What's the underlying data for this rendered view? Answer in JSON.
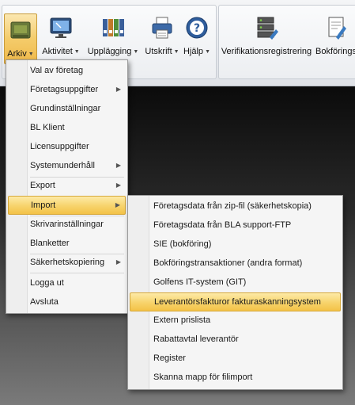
{
  "ribbon": {
    "buttons": [
      {
        "label": "Arkiv",
        "icon": "archive-icon",
        "active": true
      },
      {
        "label": "Aktivitet",
        "icon": "monitor-icon"
      },
      {
        "label": "Upplägging",
        "icon": "binders-icon"
      },
      {
        "label": "Utskrift",
        "icon": "printer-icon"
      },
      {
        "label": "Hjälp",
        "icon": "help-icon"
      },
      {
        "label": "Verifikationsregistrering",
        "icon": "server-edit-icon"
      },
      {
        "label": "Bokförings",
        "icon": "document-pen-icon"
      }
    ]
  },
  "arkiv_menu": {
    "items": [
      {
        "label": "Val av företag",
        "submenu": false
      },
      {
        "label": "Företagsuppgifter",
        "submenu": true
      },
      {
        "label": "Grundinställningar",
        "submenu": false
      },
      {
        "label": "BL Klient",
        "submenu": false
      },
      {
        "label": "Licensuppgifter",
        "submenu": false
      },
      {
        "label": "Systemunderhåll",
        "submenu": true
      },
      {
        "label": "Export",
        "submenu": true
      },
      {
        "label": "Import",
        "submenu": true,
        "highlighted": true
      },
      {
        "label": "Skrivarinställningar",
        "submenu": false
      },
      {
        "label": "Blanketter",
        "submenu": false
      },
      {
        "label": "Säkerhetskopiering",
        "submenu": true
      },
      {
        "label": "Logga ut",
        "submenu": false
      },
      {
        "label": "Avsluta",
        "submenu": false
      }
    ]
  },
  "import_menu": {
    "items": [
      {
        "label": "Företagsdata från zip-fil (säkerhetskopia)"
      },
      {
        "label": "Företagsdata från BLA support-FTP"
      },
      {
        "label": "SIE (bokföring)"
      },
      {
        "label": "Bokföringstransaktioner (andra format)"
      },
      {
        "label": "Golfens IT-system (GIT)"
      },
      {
        "label": "Leverantörsfakturor fakturaskanningsystem",
        "highlighted": true
      },
      {
        "label": "Extern prislista"
      },
      {
        "label": "Rabattavtal leverantör"
      },
      {
        "label": "Register"
      },
      {
        "label": "Skanna mapp för filimport"
      }
    ]
  },
  "colors": {
    "highlight": "#f7d36b",
    "highlight_border": "#d6a83b",
    "menu_bg": "#f5f5f5"
  }
}
